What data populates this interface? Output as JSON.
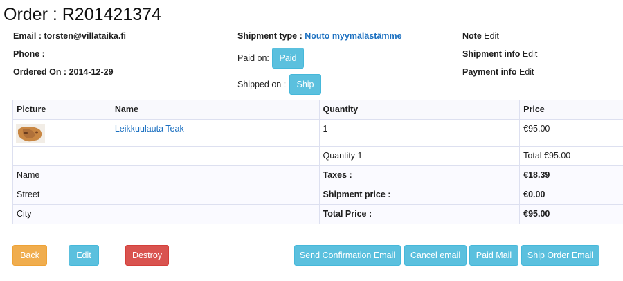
{
  "page": {
    "title": "Order : R201421374"
  },
  "info": {
    "email_label": "Email :",
    "email_value": "torsten@villataika.fi",
    "phone_label": "Phone :",
    "ordered_label": "Ordered On :",
    "ordered_value": "2014-12-29",
    "shipment_type_label": "Shipment type :",
    "shipment_type_value": "Nouto myymälästämme",
    "paid_label": "Paid on:",
    "paid_button": "Paid",
    "shipped_label": "Shipped on :",
    "ship_button": "Ship",
    "note_label": "Note",
    "shipment_info_label": "Shipment info",
    "payment_info_label": "Payment info",
    "edit_label": "Edit"
  },
  "table": {
    "headers": [
      "Picture",
      "Name",
      "Quantity",
      "Price"
    ],
    "product": {
      "name": "Leikkuulauta Teak",
      "quantity": "1",
      "price": "€95.00"
    },
    "summary": {
      "quantity": "Quantity 1",
      "total": "Total €95.00"
    },
    "rows": [
      {
        "left": "Name",
        "label": "Taxes :",
        "value": "€18.39"
      },
      {
        "left": "Street",
        "label": "Shipment price :",
        "value": "€0.00"
      },
      {
        "left": "City",
        "label": "Total Price :",
        "value": "€95.00"
      }
    ]
  },
  "actions": {
    "back": "Back",
    "edit": "Edit",
    "destroy": "Destroy",
    "send_confirmation": "Send Confirmation Email",
    "cancel_email": "Cancel email",
    "paid_mail": "Paid Mail",
    "ship_order_email": "Ship Order Email"
  },
  "colors": {
    "info": "#5bc0de",
    "warning": "#f0ad4e",
    "danger": "#d9534f",
    "link": "#1a6fc0"
  }
}
